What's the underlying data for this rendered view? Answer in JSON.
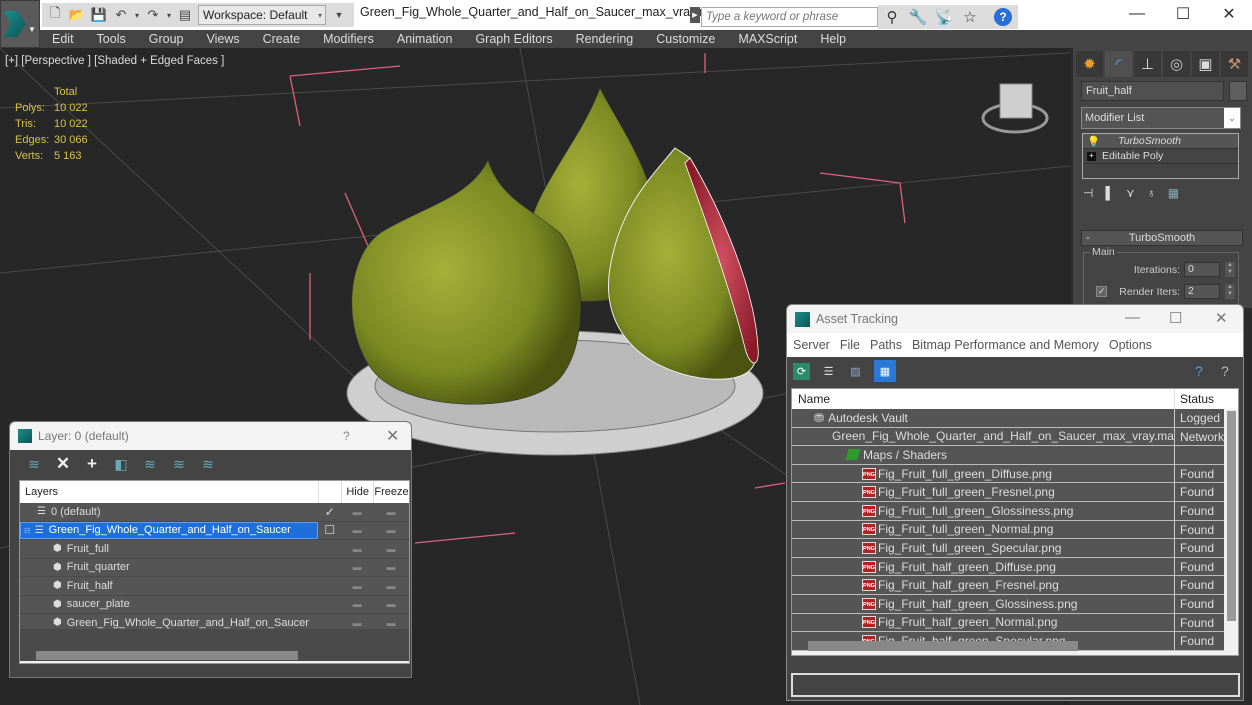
{
  "titlebar": {
    "workspace_label": "Workspace: Default",
    "file_title": "Green_Fig_Whole_Quarter_and_Half_on_Saucer_max_vray.max",
    "search_placeholder": "Type a keyword or phrase",
    "window_controls": [
      "minimize",
      "maximize",
      "close"
    ]
  },
  "menubar": {
    "items": [
      "Edit",
      "Tools",
      "Group",
      "Views",
      "Create",
      "Modifiers",
      "Animation",
      "Graph Editors",
      "Rendering",
      "Customize",
      "MAXScript",
      "Help"
    ]
  },
  "viewport": {
    "label": "[+] [Perspective ] [Shaded + Edged Faces ]",
    "stats": {
      "header": "Total",
      "rows": [
        {
          "key": "Polys:",
          "value": "10 022"
        },
        {
          "key": "Tris:",
          "value": "10 022"
        },
        {
          "key": "Edges:",
          "value": "30 066"
        },
        {
          "key": "Verts:",
          "value": "5 163"
        }
      ]
    }
  },
  "command_panel": {
    "tabs": [
      "create",
      "modify",
      "hierarchy",
      "motion",
      "display",
      "utilities"
    ],
    "object_name": "Fruit_half",
    "modifier_list_label": "Modifier List",
    "stack": [
      "TurboSmooth",
      "Editable Poly"
    ],
    "turbosmooth": {
      "title": "TurboSmooth",
      "group": "Main",
      "iterations_label": "Iterations:",
      "iterations_value": "0",
      "render_iters_label": "Render Iters:",
      "render_iters_value": "2",
      "render_iters_checked": true
    }
  },
  "layer_window": {
    "title": "Layer: 0 (default)",
    "help": "?",
    "columns": [
      "Layers",
      "",
      "Hide",
      "Freeze"
    ],
    "rows": [
      {
        "name": "0 (default)",
        "type": "layer",
        "current": true,
        "selected": false,
        "indent": 1
      },
      {
        "name": "Green_Fig_Whole_Quarter_and_Half_on_Saucer",
        "type": "layer",
        "current": false,
        "selected": true,
        "indent": 0
      },
      {
        "name": "Fruit_full",
        "type": "object",
        "indent": 2
      },
      {
        "name": "Fruit_quarter",
        "type": "object",
        "indent": 2
      },
      {
        "name": "Fruit_half",
        "type": "object",
        "indent": 2
      },
      {
        "name": "saucer_plate",
        "type": "object",
        "indent": 2
      },
      {
        "name": "Green_Fig_Whole_Quarter_and_Half_on_Saucer",
        "type": "object",
        "indent": 2
      }
    ]
  },
  "asset_window": {
    "title": "Asset Tracking",
    "menu": [
      "Server",
      "File",
      "Paths",
      "Bitmap Performance and Memory",
      "Options"
    ],
    "columns": [
      "Name",
      "Status"
    ],
    "rows": [
      {
        "name": "Autodesk Vault",
        "status": "Logged Out",
        "icon": "vault",
        "indent": 1
      },
      {
        "name": "Green_Fig_Whole_Quarter_and_Half_on_Saucer_max_vray.max",
        "status": "Network",
        "icon": "max",
        "indent": 2
      },
      {
        "name": "Maps / Shaders",
        "status": "",
        "icon": "maps",
        "indent": 3
      },
      {
        "name": "Fig_Fruit_full_green_Diffuse.png",
        "status": "Found",
        "icon": "png",
        "indent": 4
      },
      {
        "name": "Fig_Fruit_full_green_Fresnel.png",
        "status": "Found",
        "icon": "png",
        "indent": 4
      },
      {
        "name": "Fig_Fruit_full_green_Glossiness.png",
        "status": "Found",
        "icon": "png",
        "indent": 4
      },
      {
        "name": "Fig_Fruit_full_green_Normal.png",
        "status": "Found",
        "icon": "png",
        "indent": 4
      },
      {
        "name": "Fig_Fruit_full_green_Specular.png",
        "status": "Found",
        "icon": "png",
        "indent": 4
      },
      {
        "name": "Fig_Fruit_half_green_Diffuse.png",
        "status": "Found",
        "icon": "png",
        "indent": 4
      },
      {
        "name": "Fig_Fruit_half_green_Fresnel.png",
        "status": "Found",
        "icon": "png",
        "indent": 4
      },
      {
        "name": "Fig_Fruit_half_green_Glossiness.png",
        "status": "Found",
        "icon": "png",
        "indent": 4
      },
      {
        "name": "Fig_Fruit_half_green_Normal.png",
        "status": "Found",
        "icon": "png",
        "indent": 4
      },
      {
        "name": "Fig_Fruit_half_green_Specular.png",
        "status": "Found",
        "icon": "png",
        "indent": 4
      }
    ]
  },
  "colors": {
    "accent": "#1e6fd9",
    "stats_text": "#d8c24a",
    "fig_green": "#8a9a2a",
    "fig_flesh": "#b83040"
  }
}
